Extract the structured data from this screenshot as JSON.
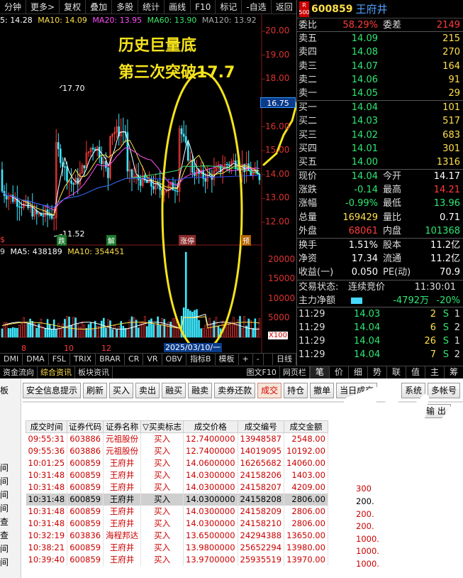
{
  "toolbar": {
    "items": [
      "分钟",
      "更多>",
      "复权",
      "叠加",
      "多股",
      "统计",
      "画线",
      "F10",
      "标记",
      "-自选",
      "返回"
    ]
  },
  "ma_line": {
    "ma5": "5: 14.28",
    "ma10": "MA10: 14.09",
    "ma20": "MA20: 13.95",
    "ma60": "MA60: 13.90",
    "ma120": "MA120: 13.92"
  },
  "price_axis": [
    "20.00",
    "19.00",
    "18.00",
    "17.00",
    "16.00",
    "15.00",
    "14.00",
    "13.00",
    "12.00"
  ],
  "current_price_tag": "16.75",
  "high_marker": "17.70",
  "low_marker": "11.52",
  "event_labels": {
    "e1": "跌",
    "e2": "解",
    "e3": "涨",
    "e4": "预",
    "e5": "$"
  },
  "limit_up_label": "涨停",
  "annotation": {
    "line1": "历史巨量底",
    "line2": "第三次突破17.7"
  },
  "volume_bar": {
    "vol": "9",
    "ma5": "MA5: 438189",
    "ma10": "MA10: 354451"
  },
  "volume_axis": [
    "20000",
    "15000",
    "10000",
    "5000",
    "X100"
  ],
  "x_labels": [
    "8",
    "10",
    "12"
  ],
  "crosshair_date": "2025/03/10/一",
  "indicator_tabs": [
    "DMI",
    "DMA",
    "FSL",
    "TRIX",
    "BRAR",
    "CR",
    "VR",
    "OBV",
    "指标B",
    "模板",
    "日线"
  ],
  "indicator_extra": [
    "+",
    "-"
  ],
  "info_tabs": [
    "资金流向",
    "综合资讯",
    "板块资讯"
  ],
  "info_tabs_right": [
    "图文F10",
    "网页栏"
  ],
  "quote_tabs": [
    "笔",
    "价",
    "细",
    "势",
    "联",
    "值",
    "主",
    "筹"
  ],
  "quote": {
    "badge_top": "R",
    "badge_bottom": "500",
    "code": "600859",
    "name": "王府井",
    "weibi_label": "委比",
    "weibi": "58.29%",
    "weicha_label": "委差",
    "weicha": "2149",
    "asks": [
      {
        "label": "卖五",
        "price": "14.09",
        "vol": "215"
      },
      {
        "label": "卖四",
        "price": "14.08",
        "vol": "270"
      },
      {
        "label": "卖三",
        "price": "14.07",
        "vol": "164"
      },
      {
        "label": "卖二",
        "price": "14.06",
        "vol": "91"
      },
      {
        "label": "卖一",
        "price": "14.05",
        "vol": "29"
      }
    ],
    "bids": [
      {
        "label": "买一",
        "price": "14.04",
        "vol": "101"
      },
      {
        "label": "买二",
        "price": "14.03",
        "vol": "517"
      },
      {
        "label": "买三",
        "price": "14.02",
        "vol": "683"
      },
      {
        "label": "买四",
        "price": "14.01",
        "vol": "301"
      },
      {
        "label": "买五",
        "price": "14.00",
        "vol": "1316"
      }
    ],
    "stats": [
      {
        "l1": "现价",
        "v1": "14.04",
        "l2": "今开",
        "v2": "14.17"
      },
      {
        "l1": "涨跌",
        "v1": "-0.14",
        "l2": "最高",
        "v2": "14.21"
      },
      {
        "l1": "涨幅",
        "v1": "-0.99%",
        "l2": "最低",
        "v2": "13.96"
      },
      {
        "l1": "总量",
        "v1": "169429",
        "l2": "量比",
        "v2": "0.71"
      },
      {
        "l1": "外盘",
        "v1": "68061",
        "l2": "内盘",
        "v2": "101368"
      }
    ],
    "fund": [
      {
        "l1": "换手",
        "v1": "1.51%",
        "l2": "股本",
        "v2": "11.2亿"
      },
      {
        "l1": "净资",
        "v1": "17.34",
        "l2": "流通",
        "v2": "11.2亿"
      },
      {
        "l1": "收益(一)",
        "v1": "0.050",
        "l2": "PE(动)",
        "v2": "70.9"
      }
    ],
    "trade_state_label": "交易状态:",
    "trade_state": "连续竞价",
    "trade_time": "11:30:01",
    "net_label": "主力净额",
    "net_value": "-4792万",
    "net_pct": "-20%",
    "ticks": [
      {
        "time": "11:29",
        "price": "14.03",
        "vol": "2",
        "side": "S",
        "n": "1"
      },
      {
        "time": "11:29",
        "price": "14.04",
        "vol": "6",
        "side": "S",
        "n": "2"
      },
      {
        "time": "11:29",
        "price": "14.04",
        "vol": "26",
        "side": "S",
        "n": "1"
      },
      {
        "time": "11:29",
        "price": "14.04",
        "vol": "7",
        "side": "S",
        "n": "2"
      }
    ]
  },
  "trade_panel": {
    "left_marks": [
      "板",
      "间",
      "间",
      "间",
      "间",
      "查",
      "查",
      "间",
      "间"
    ],
    "buttons": [
      "安全信息提示",
      "刷新",
      "买入",
      "卖出",
      "融买",
      "融卖",
      "卖券还款",
      "成交",
      "持仓",
      "撤单",
      "当日成交"
    ],
    "buttons_right": [
      "系统",
      "多帐号"
    ],
    "output_button": "输 出",
    "table_headers": [
      "成交时间",
      "证券代码",
      "证券名称",
      "▽买卖标志",
      "成交价格",
      "成交编号",
      "成交金额"
    ],
    "rows": [
      {
        "time": "09:55:31",
        "code": "603886",
        "name": "元祖股份",
        "side": "买入",
        "price": "12.7400000",
        "no": "13948587",
        "amount": "2548.00"
      },
      {
        "time": "09:55:36",
        "code": "603886",
        "name": "元祖股份",
        "side": "买入",
        "price": "12.7400000",
        "no": "14019095",
        "amount": "10192.00"
      },
      {
        "time": "10:01:25",
        "code": "600859",
        "name": "王府井",
        "side": "买入",
        "price": "14.0600000",
        "no": "16265682",
        "amount": "14060.00"
      },
      {
        "time": "10:31:48",
        "code": "600859",
        "name": "王府井",
        "side": "买入",
        "price": "14.0300000",
        "no": "24158206",
        "amount": "1403.00"
      },
      {
        "time": "10:31:48",
        "code": "600859",
        "name": "王府井",
        "side": "买入",
        "price": "14.0300000",
        "no": "24158207",
        "amount": "4209.00"
      },
      {
        "time": "10:31:48",
        "code": "600859",
        "name": "王府井",
        "side": "买入",
        "price": "14.0300000",
        "no": "24158208",
        "amount": "2806.00"
      },
      {
        "time": "10:31:48",
        "code": "600859",
        "name": "王府井",
        "side": "买入",
        "price": "14.0300000",
        "no": "24158209",
        "amount": "2806.00"
      },
      {
        "time": "10:31:48",
        "code": "600859",
        "name": "王府井",
        "side": "买入",
        "price": "14.0300000",
        "no": "24158210",
        "amount": "2806.00"
      },
      {
        "time": "10:32:19",
        "code": "603836",
        "name": "海程邦达",
        "side": "买入",
        "price": "13.6500000",
        "no": "24294388",
        "amount": "13650.00"
      },
      {
        "time": "10:38:21",
        "code": "600859",
        "name": "王府井",
        "side": "买入",
        "price": "13.9800000",
        "no": "25652294",
        "amount": "13980.00"
      },
      {
        "time": "10:39:40",
        "code": "600859",
        "name": "王府井",
        "side": "买入",
        "price": "13.9700000",
        "no": "25935519",
        "amount": "13970.00"
      }
    ],
    "extra_col": [
      "",
      "",
      "",
      "",
      "300",
      "200.",
      "200.",
      "200.",
      "1000.",
      "1000.",
      "1000."
    ]
  },
  "colors": {
    "up": "#ff3b3b",
    "down": "#2ee872",
    "accent": "#ffe04a",
    "annotation": "#f5e31b"
  }
}
